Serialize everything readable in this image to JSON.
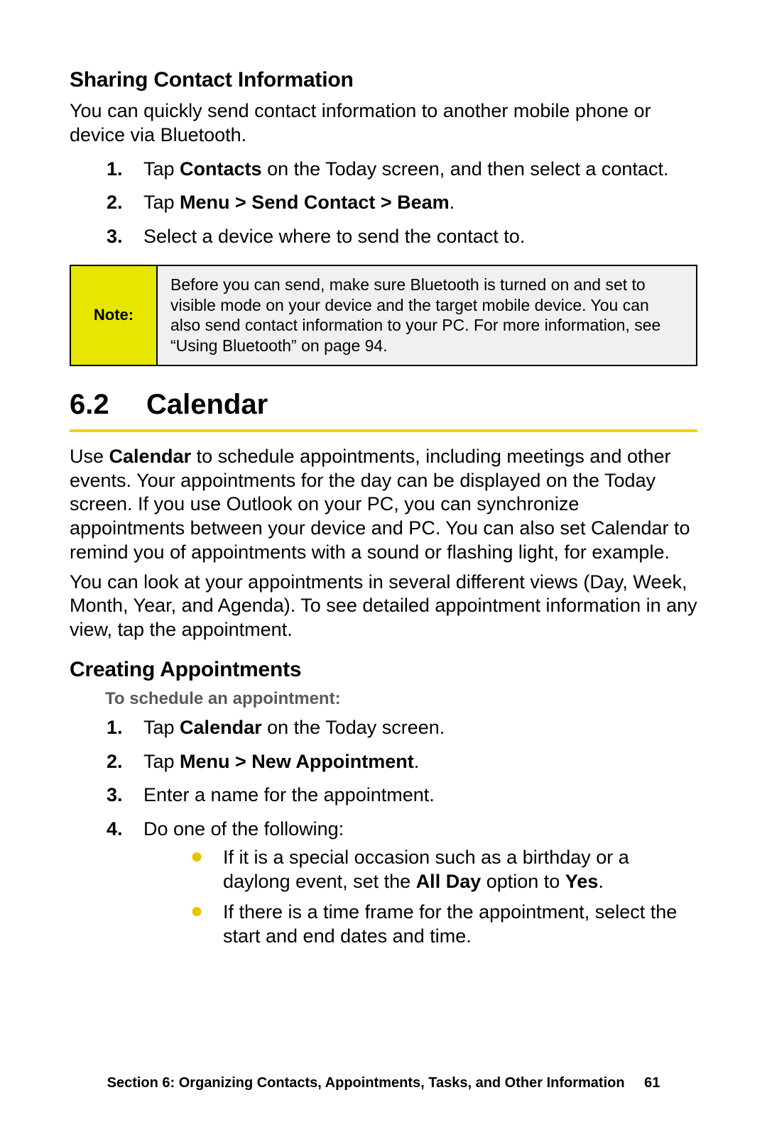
{
  "sharing": {
    "heading": "Sharing Contact Information",
    "intro": "You can quickly send contact information to another mobile phone or device via Bluetooth.",
    "steps": {
      "s1_pre": "Tap ",
      "s1_b": "Contacts",
      "s1_post": " on the Today screen, and then select a contact.",
      "s2_pre": "Tap ",
      "s2_b": "Menu > Send Contact > Beam",
      "s2_post": ".",
      "s3": "Select a device where to send the contact to."
    },
    "note_label": "Note:",
    "note_text": "Before you can send, make sure Bluetooth is turned on and set to visible mode on your device and the target mobile device. You can also send contact information to your PC. For more information, see “Using Bluetooth” on page 94."
  },
  "calendar": {
    "num": "6.2",
    "title": "Calendar",
    "p1_pre": "Use ",
    "p1_b": "Calendar",
    "p1_post": " to schedule appointments, including meetings and other events. Your appointments for the day can be displayed on the Today screen. If you use Outlook on your PC, you can synchronize appointments between your device and PC. You can also set Calendar to remind you of appointments with a sound or flashing light, for example.",
    "p2": "You can look at your appointments in several different views (Day, Week, Month, Year, and Agenda). To see detailed appointment information in any view, tap the appointment."
  },
  "creating": {
    "heading": "Creating Appointments",
    "subhead": "To schedule an appointment:",
    "steps": {
      "s1_pre": "Tap ",
      "s1_b": "Calendar",
      "s1_post": " on the Today screen.",
      "s2_pre": "Tap ",
      "s2_b": "Menu > New Appointment",
      "s2_post": ".",
      "s3": "Enter a name for the appointment.",
      "s4": "Do one of the following:"
    },
    "bullets": {
      "b1_pre": "If it is a special occasion such as a birthday or a daylong event, set the ",
      "b1_b1": "All Day",
      "b1_mid": " option to ",
      "b1_b2": "Yes",
      "b1_post": ".",
      "b2": "If there is a time frame for the appointment, select the start and end dates and time."
    }
  },
  "footer": {
    "text": "Section 6: Organizing Contacts, Appointments, Tasks, and Other Information",
    "page": "61"
  },
  "marks": {
    "n1": "1.",
    "n2": "2.",
    "n3": "3.",
    "n4": "4.",
    "dot": "●"
  }
}
